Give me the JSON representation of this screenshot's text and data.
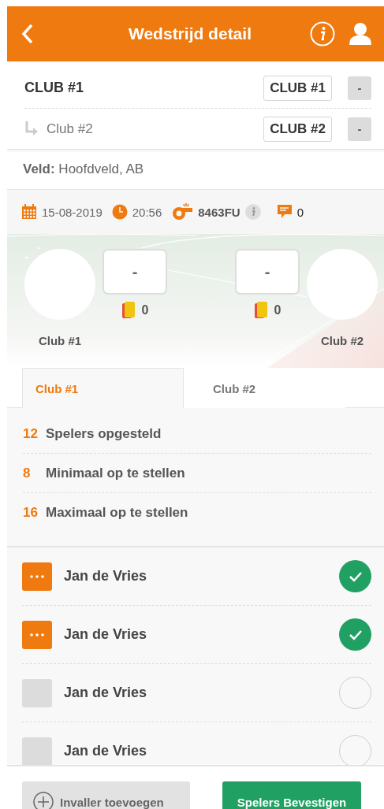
{
  "header": {
    "title": "Wedstrijd detail"
  },
  "clubs": [
    {
      "name": "CLUB #1",
      "tag": "CLUB #1",
      "action": "-",
      "sub": false
    },
    {
      "name": "Club #2",
      "tag": "CLUB #2",
      "action": "-",
      "sub": true
    }
  ],
  "field": {
    "label": "Veld:",
    "value": "Hoofdveld, AB"
  },
  "info": {
    "date": "15-08-2019",
    "time": "20:56",
    "referee": "8463FU",
    "comments": "0"
  },
  "teams": [
    {
      "name": "Club #1",
      "score": "-",
      "cards": "0"
    },
    {
      "name": "Club #2",
      "score": "-",
      "cards": "0"
    }
  ],
  "tabs": [
    {
      "label": "Club #1",
      "selected": true
    },
    {
      "label": "Club #2",
      "selected": false
    }
  ],
  "stats": [
    {
      "number": "12",
      "label": "Spelers opgesteld"
    },
    {
      "number": "8",
      "label": "Minimaal op te stellen"
    },
    {
      "number": "16",
      "label": "Maximaal op te stellen"
    }
  ],
  "players": [
    {
      "name": "Jan de Vries",
      "has_actions": true,
      "checked": true
    },
    {
      "name": "Jan de Vries",
      "has_actions": true,
      "checked": true
    },
    {
      "name": "Jan de Vries",
      "has_actions": false,
      "checked": false
    },
    {
      "name": "Jan de Vries",
      "has_actions": false,
      "checked": false
    }
  ],
  "footer": {
    "add_button": "Invaller toevoegen",
    "confirm_button": "Spelers Bevestigen"
  }
}
